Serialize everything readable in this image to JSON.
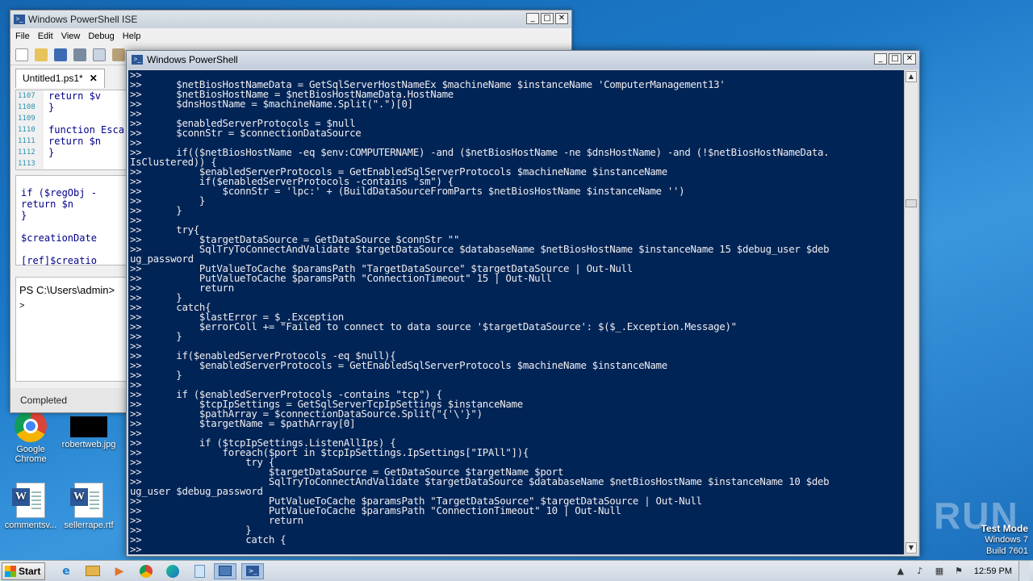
{
  "desktop": {
    "icons": [
      {
        "label": "Google Chrome",
        "icon": "chrome-icon"
      },
      {
        "label": "robertweb.jpg",
        "icon": "image-file-icon"
      },
      {
        "label": "commentsv...",
        "icon": "word-doc-icon"
      },
      {
        "label": "sellerrape.rtf",
        "icon": "word-doc-icon"
      }
    ],
    "watermark": "ANY RUN",
    "test_mode": {
      "line1": "Test Mode",
      "line2": "Windows 7",
      "line3": "Build 7601"
    }
  },
  "ise_window": {
    "title": "Windows PowerShell ISE",
    "menu": [
      "File",
      "Edit",
      "View",
      "Debug",
      "Help"
    ],
    "tab_label": "Untitled1.ps1*",
    "editor_lines": [
      {
        "n": "1107",
        "code": "    return $v"
      },
      {
        "n": "1108",
        "code": "}"
      },
      {
        "n": "1109",
        "code": ""
      },
      {
        "n": "1110",
        "code": "function Esca"
      },
      {
        "n": "1111",
        "code": "    return $n"
      },
      {
        "n": "1112",
        "code": "}"
      },
      {
        "n": "1113",
        "code": ""
      }
    ],
    "pane2_lines": [
      "    if ($regObj -",
      "        return $n",
      "    }",
      "",
      "    $creationDate",
      "",
      "    [ref]$creatio"
    ],
    "console_prompt": "PS C:\\Users\\admin>",
    "console_cursor": ">",
    "status": "Completed"
  },
  "ps_window": {
    "title": "Windows PowerShell",
    "lines": [
      ">>",
      ">>      $netBiosHostNameData = GetSqlServerHostNameEx $machineName $instanceName 'ComputerManagement13'",
      ">>      $netBiosHostName = $netBiosHostNameData.HostName",
      ">>      $dnsHostName = $machineName.Split(\".\")[0]",
      ">>",
      ">>      $enabledServerProtocols = $null",
      ">>      $connStr = $connectionDataSource",
      ">>",
      ">>      if(($netBiosHostName -eq $env:COMPUTERNAME) -and ($netBiosHostName -ne $dnsHostName) -and (!$netBiosHostNameData.",
      "IsClustered)) {",
      ">>          $enabledServerProtocols = GetEnabledSqlServerProtocols $machineName $instanceName",
      ">>          if($enabledServerProtocols -contains \"sm\") {",
      ">>              $connStr = 'lpc:' + (BuildDataSourceFromParts $netBiosHostName $instanceName '')",
      ">>          }",
      ">>      }",
      ">>",
      ">>      try{",
      ">>          $targetDataSource = GetDataSource $connStr \"\"",
      ">>          SqlTryToConnectAndValidate $targetDataSource $databaseName $netBiosHostName $instanceName 15 $debug_user $deb",
      "ug_password",
      ">>          PutValueToCache $paramsPath \"TargetDataSource\" $targetDataSource | Out-Null",
      ">>          PutValueToCache $paramsPath \"ConnectionTimeout\" 15 | Out-Null",
      ">>          return",
      ">>      }",
      ">>      catch{",
      ">>          $lastError = $_.Exception",
      ">>          $errorColl += \"Failed to connect to data source '$targetDataSource': $($_.Exception.Message)\"",
      ">>      }",
      ">>",
      ">>      if($enabledServerProtocols -eq $null){",
      ">>          $enabledServerProtocols = GetEnabledSqlServerProtocols $machineName $instanceName",
      ">>      }",
      ">>",
      ">>      if ($enabledServerProtocols -contains \"tcp\") {",
      ">>          $tcpIpSettings = GetSqlServerTcpIpSettings $instanceName",
      ">>          $pathArray = $connectionDataSource.Split(\"{'\\'}\")",
      ">>          $targetName = $pathArray[0]",
      ">>",
      ">>          if ($tcpIpSettings.ListenAllIps) {",
      ">>              foreach($port in $tcpIpSettings.IpSettings[\"IPAll\"]){",
      ">>                  try {",
      ">>                      $targetDataSource = GetDataSource $targetName $port",
      ">>                      SqlTryToConnectAndValidate $targetDataSource $databaseName $netBiosHostName $instanceName 10 $deb",
      "ug_user $debug_password",
      ">>                      PutValueToCache $paramsPath \"TargetDataSource\" $targetDataSource | Out-Null",
      ">>                      PutValueToCache $paramsPath \"ConnectionTimeout\" 10 | Out-Null",
      ">>                      return",
      ">>                  }",
      ">>                  catch {",
      ">>"
    ]
  },
  "taskbar": {
    "start_label": "Start",
    "apps": [
      "ie-icon",
      "explorer-icon",
      "media-player-icon",
      "chrome-icon",
      "edge-icon",
      "notepad-icon",
      "ise-icon",
      "powershell-icon"
    ],
    "clock": "12:59 PM"
  }
}
